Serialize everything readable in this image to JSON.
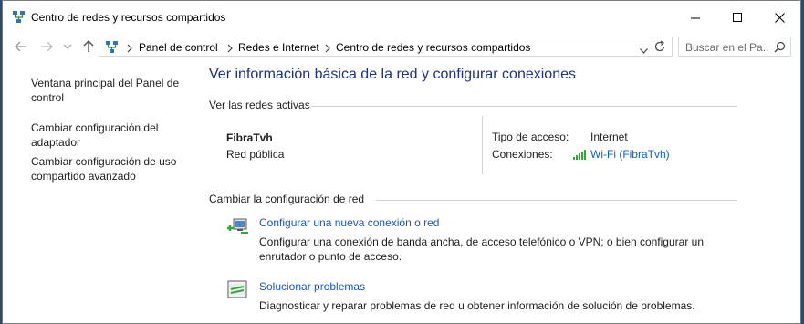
{
  "window": {
    "title": "Centro de redes y recursos compartidos",
    "icon": "network-center-icon"
  },
  "address": {
    "breadcrumbs": [
      "Panel de control",
      "Redes e Internet",
      "Centro de redes y recursos compartidos"
    ],
    "search_placeholder": "Buscar en el Pa..."
  },
  "sidebar": {
    "links": [
      "Ventana principal del Panel de control",
      "Cambiar configuración del adaptador",
      "Cambiar configuración de uso compartido avanzado"
    ]
  },
  "main": {
    "title": "Ver información básica de la red y configurar conexiones",
    "active_networks_header": "Ver las redes activas",
    "network": {
      "name": "FibraTvh",
      "type": "Red pública",
      "access_label": "Tipo de acceso:",
      "access_value": "Internet",
      "connections_label": "Conexiones:",
      "connections_value": "Wi-Fi (FibraTvh)"
    },
    "change_header": "Cambiar la configuración de red",
    "tasks": [
      {
        "icon": "new-connection-icon",
        "link": "Configurar una nueva conexión o red",
        "desc": "Configurar una conexión de banda ancha, de acceso telefónico o VPN; o bien configurar un enrutador o punto de acceso."
      },
      {
        "icon": "troubleshoot-icon",
        "link": "Solucionar problemas",
        "desc": "Diagnosticar y reparar problemas de red u obtener información de solución de problemas."
      }
    ]
  },
  "colors": {
    "title_blue": "#1e3287",
    "link_blue": "#0a65c9",
    "wifi_green": "#2eaa2e"
  }
}
